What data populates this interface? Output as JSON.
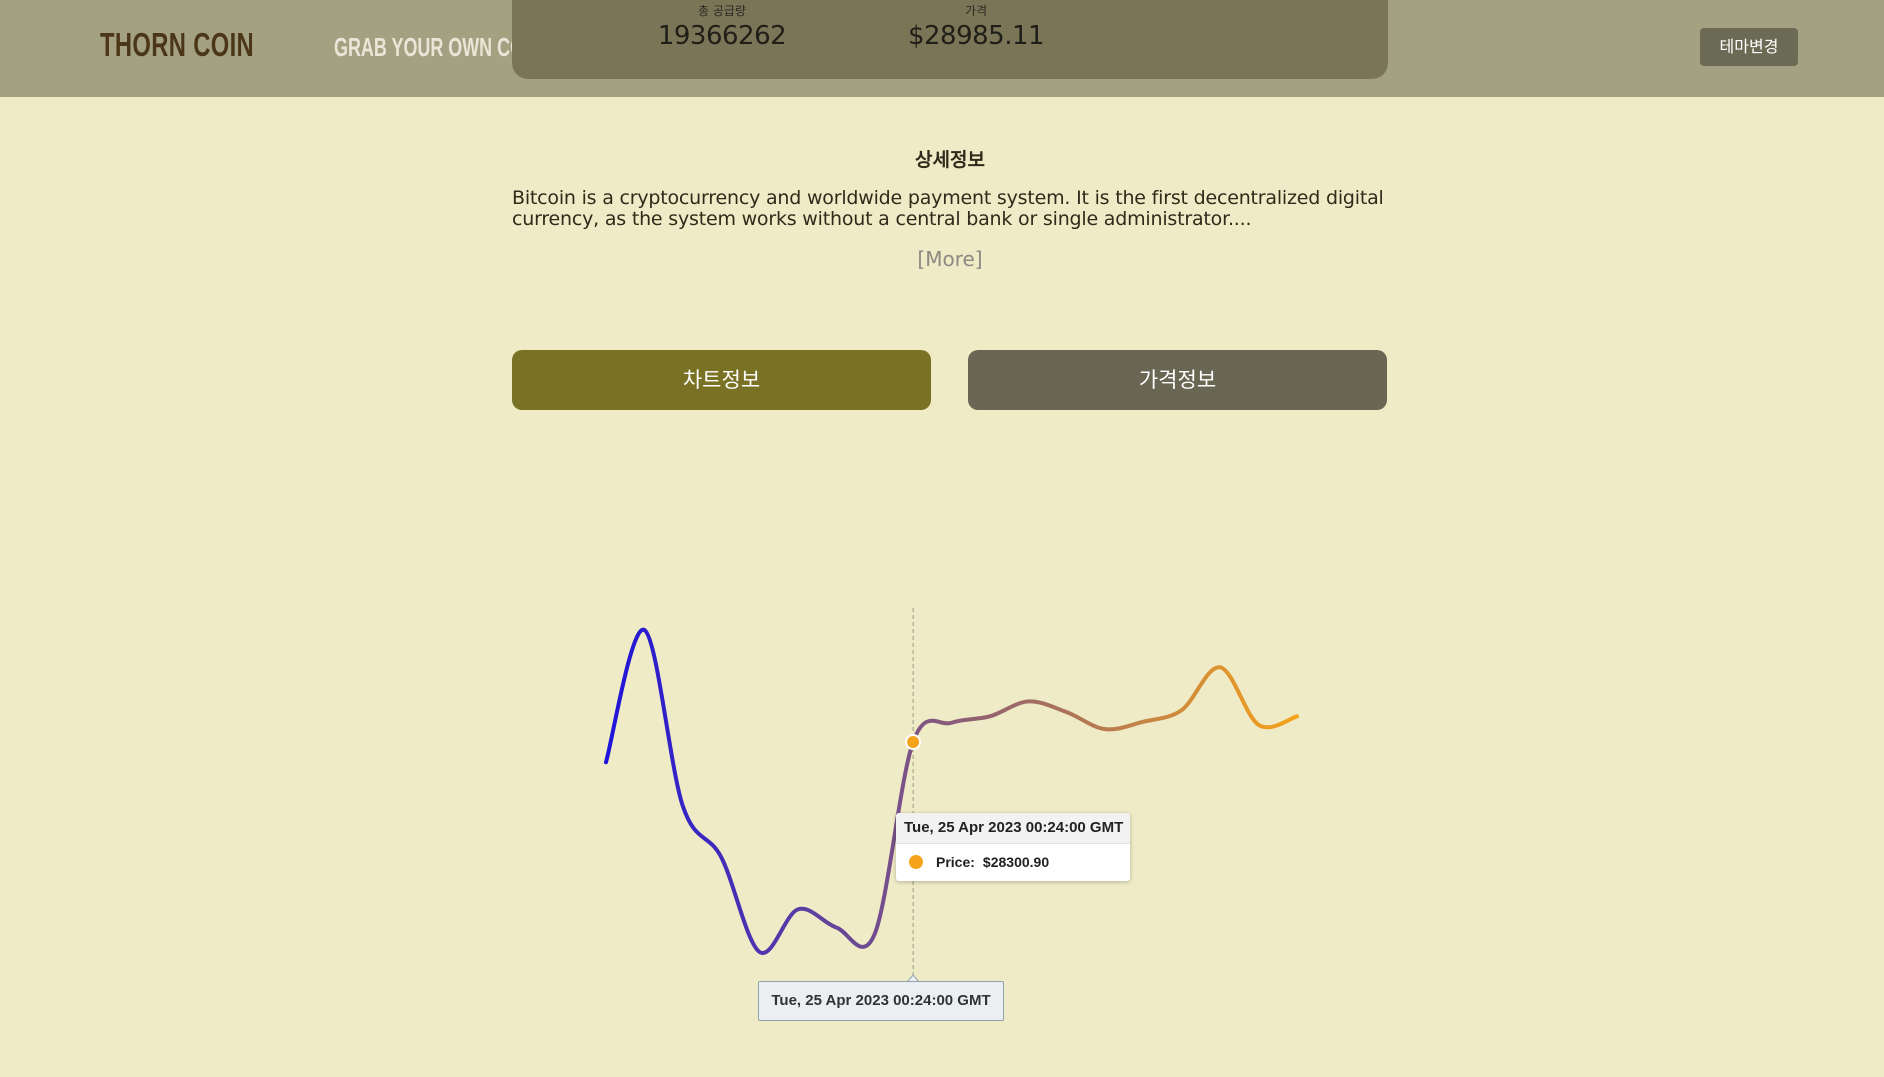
{
  "header": {
    "logo": "THORN COIN",
    "tagline": "GRAB YOUR OWN COIN!",
    "stats": {
      "supply_label": "총 공급량",
      "supply_value": "19366262",
      "price_label": "가격",
      "price_value": "$28985.11"
    },
    "theme_button": "테마변경"
  },
  "detail": {
    "title": "상세정보",
    "description": "Bitcoin is a cryptocurrency and worldwide payment system. It is the first decentralized digital currency, as the system works without a central bank or single administrator....",
    "more": "[More]"
  },
  "tabs": {
    "chart": "차트정보",
    "price": "가격정보"
  },
  "colors": {
    "background": "#efebc7",
    "header": "#a4a183",
    "tab_active": "#797224",
    "tab_inactive": "#696754",
    "line_start": "#1e14d9",
    "line_end": "#f5a31a",
    "marker": "#f5a31a"
  },
  "chart_data": {
    "type": "line",
    "series": [
      {
        "name": "Price",
        "values": [
          28205,
          28825,
          28000,
          27760,
          27315,
          27515,
          27430,
          27400,
          28300,
          28390,
          28420,
          28490,
          28440,
          28360,
          28395,
          28450,
          28650,
          28380,
          28420
        ]
      }
    ],
    "gradient": [
      "#1e14d9",
      "#f5a31a"
    ],
    "grid": false,
    "axes_visible": false,
    "tooltip": {
      "date": "Tue, 25 Apr 2023 00:24:00 GMT",
      "label": "Price:",
      "value": "$28300.90"
    },
    "crosshair_label": "Tue, 25 Apr 2023 00:24:00 GMT"
  }
}
